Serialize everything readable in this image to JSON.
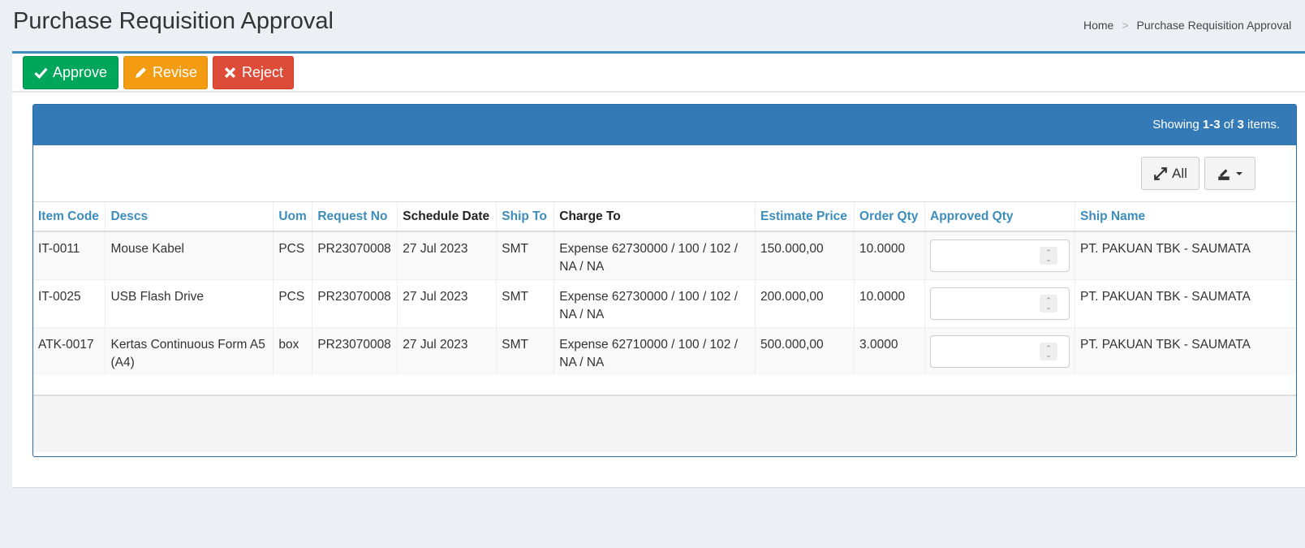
{
  "page": {
    "title": "Purchase Requisition Approval"
  },
  "breadcrumb": {
    "home": "Home",
    "separator": ">",
    "current": "Purchase Requisition Approval"
  },
  "toolbar": {
    "approve": "Approve",
    "revise": "Revise",
    "reject": "Reject"
  },
  "grid": {
    "summary_prefix": "Showing",
    "summary_range": "1-3",
    "summary_of": "of",
    "summary_total": "3",
    "summary_suffix": "items.",
    "toggle_all": "All",
    "columns": [
      "Item Code",
      "Descs",
      "Uom",
      "Request No",
      "Schedule Date",
      "Ship To",
      "Charge To",
      "Estimate Price",
      "Order Qty",
      "Approved Qty",
      "Ship Name"
    ],
    "rows": [
      {
        "item_code": "IT-0011",
        "descs": "Mouse Kabel",
        "uom": "PCS",
        "request_no": "PR23070008",
        "schedule_date": "27 Jul 2023",
        "ship_to": "SMT",
        "charge_to": "Expense 62730000 / 100 / 102 / NA / NA",
        "estimate_price": "150.000,00",
        "order_qty": "10.0000",
        "approved_qty": "",
        "ship_name": "PT. PAKUAN TBK - SAUMATA"
      },
      {
        "item_code": "IT-0025",
        "descs": "USB Flash Drive",
        "uom": "PCS",
        "request_no": "PR23070008",
        "schedule_date": "27 Jul 2023",
        "ship_to": "SMT",
        "charge_to": "Expense 62730000 / 100 / 102 / NA / NA",
        "estimate_price": "200.000,00",
        "order_qty": "10.0000",
        "approved_qty": "",
        "ship_name": "PT. PAKUAN TBK - SAUMATA"
      },
      {
        "item_code": "ATK-0017",
        "descs": "Kertas Continuous Form A5 (A4)",
        "uom": "box",
        "request_no": "PR23070008",
        "schedule_date": "27 Jul 2023",
        "ship_to": "SMT",
        "charge_to": "Expense 62710000 / 100 / 102 / NA / NA",
        "estimate_price": "500.000,00",
        "order_qty": "3.0000",
        "approved_qty": "",
        "ship_name": "PT. PAKUAN TBK - SAUMATA"
      }
    ]
  },
  "icons": {
    "approve": "check-icon",
    "revise": "pencil-icon",
    "reject": "times-icon",
    "all": "expand-icon",
    "export": "export-icon"
  },
  "colors": {
    "primary": "#3c8dbc",
    "heading": "#337ab7",
    "approve": "#00a65a",
    "revise": "#f39c12",
    "reject": "#dd4b39"
  }
}
